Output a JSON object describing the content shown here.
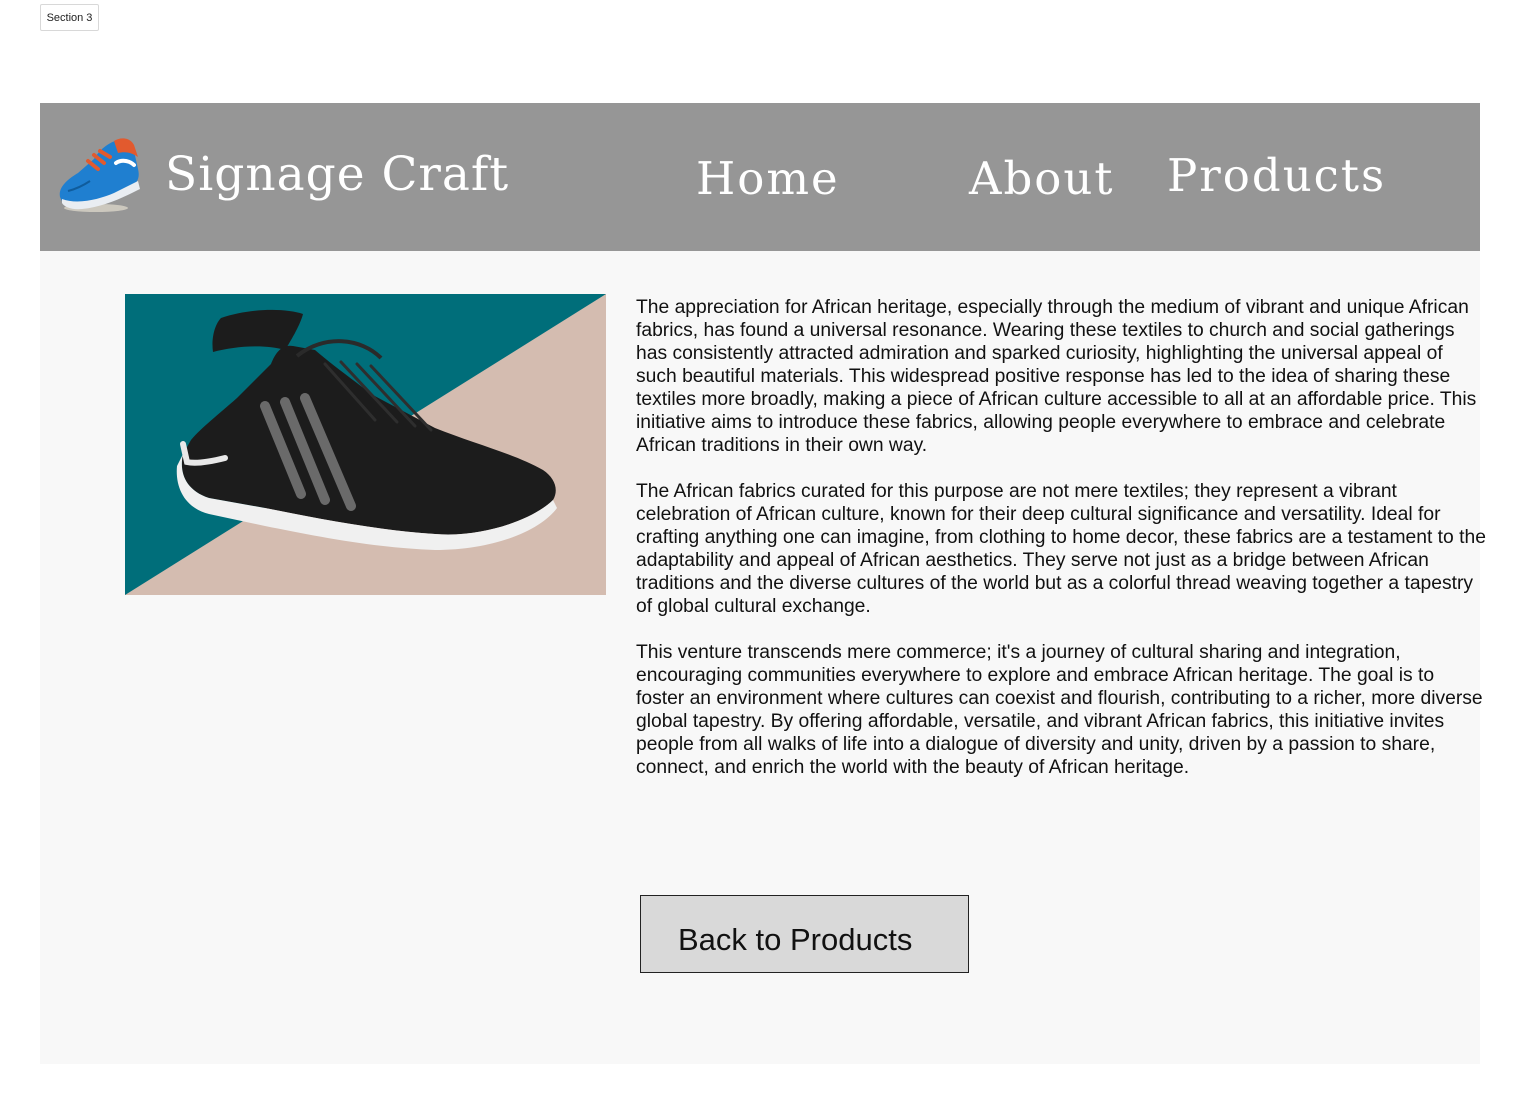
{
  "section_tag": "Section 3",
  "header": {
    "brand": "Signage Craft",
    "logo_icon": "running-shoe-icon",
    "nav": {
      "home": "Home",
      "about": "About",
      "products": "Products"
    }
  },
  "product": {
    "image_icon": "black-running-shoe-image",
    "paragraphs": [
      "The appreciation for African heritage, especially through the medium of vibrant and unique African fabrics, has found a universal resonance. Wearing these textiles to church and social gatherings has consistently attracted admiration and sparked curiosity, highlighting the universal appeal of such beautiful materials. This widespread positive response has led to the idea of sharing these textiles more broadly, making a piece of African culture accessible to all at an affordable price. This initiative aims to introduce these fabrics, allowing people everywhere to embrace and celebrate African traditions in their own way.",
      "The African fabrics curated for this purpose are not mere textiles; they represent a vibrant celebration of African culture, known for their deep cultural significance and versatility. Ideal for crafting anything one can imagine, from clothing to home decor, these fabrics are a testament to the adaptability and appeal of African aesthetics. They serve not just as a bridge between African traditions and the diverse cultures of the world but as a colorful thread weaving together a tapestry of global cultural exchange.",
      "This venture transcends mere commerce; it's a journey of cultural sharing and integration, encouraging communities everywhere to explore and embrace African heritage. The goal is to foster an environment where cultures can coexist and flourish, contributing to a richer, more diverse global tapestry. By offering affordable, versatile, and vibrant African fabrics, this initiative invites people from all walks of life into a dialogue of diversity and unity, driven by a passion to share, connect, and enrich the world with the beauty of African heritage."
    ]
  },
  "back_button": "Back to Products",
  "colors": {
    "header_bg": "#969696",
    "page_bg": "#f8f8f8",
    "image_teal": "#006e7a",
    "image_beige": "#d4bcb0",
    "button_bg": "#d9d9d9"
  }
}
